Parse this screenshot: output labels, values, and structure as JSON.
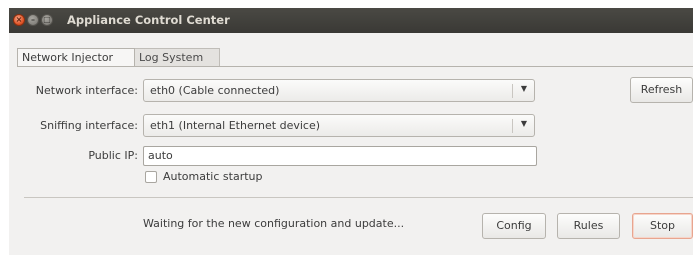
{
  "window": {
    "title": "Appliance Control Center"
  },
  "tabs": [
    {
      "label": "Network Injector",
      "active": true
    },
    {
      "label": "Log System",
      "active": false
    }
  ],
  "form": {
    "network_interface": {
      "label": "Network interface:",
      "value": "eth0 (Cable connected)"
    },
    "sniffing_interface": {
      "label": "Sniffing interface:",
      "value": "eth1 (Internal Ethernet device)"
    },
    "public_ip": {
      "label": "Public IP:",
      "value": "auto"
    },
    "automatic_startup": {
      "label": "Automatic startup",
      "checked": false
    },
    "refresh_label": "Refresh"
  },
  "footer": {
    "status": "Waiting for the new configuration and update...",
    "config_label": "Config",
    "rules_label": "Rules",
    "stop_label": "Stop"
  },
  "icons": {
    "close": "close-icon",
    "minimize": "minimize-icon",
    "maximize": "maximize-icon",
    "dropdown": "chevron-down-icon"
  },
  "colors": {
    "titlebar": "#3c3b37",
    "close_button": "#e2572a",
    "window_bg": "#f2f1f0",
    "stop_border": "#e8a58f"
  }
}
